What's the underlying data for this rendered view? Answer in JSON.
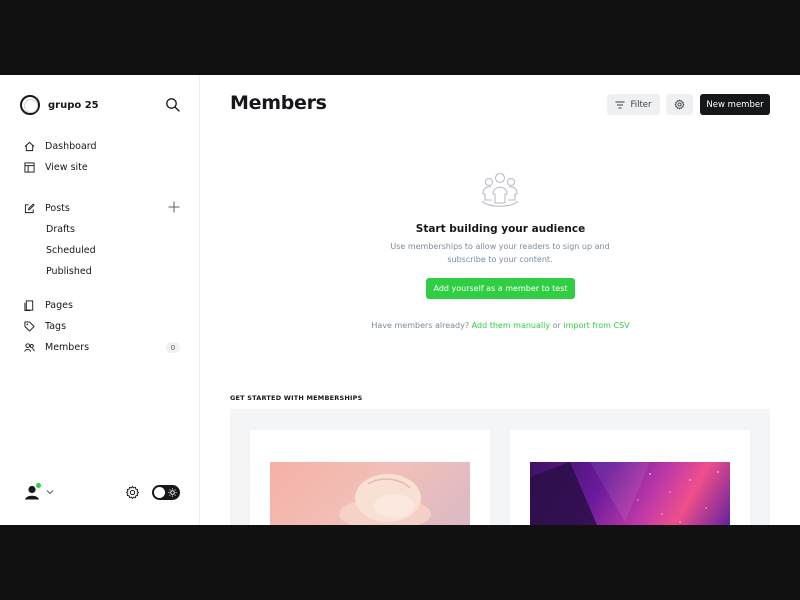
{
  "sidebar": {
    "brand_name": "grupo 25",
    "nav": {
      "dashboard": "Dashboard",
      "view_site": "View site",
      "posts": "Posts",
      "drafts": "Drafts",
      "scheduled": "Scheduled",
      "published": "Published",
      "pages": "Pages",
      "tags": "Tags",
      "members": "Members",
      "members_count": "0"
    }
  },
  "header": {
    "title": "Members",
    "filter_label": "Filter",
    "new_member_label": "New member"
  },
  "empty_state": {
    "title": "Start building your audience",
    "description": "Use memberships to allow your readers to sign up and subscribe to your content.",
    "add_self_label": "Add yourself as a member to test",
    "have_members_prefix": "Have members already?",
    "add_manually_link": "Add them manually",
    "or_text": "or",
    "import_csv_link": "import from CSV"
  },
  "get_started": {
    "label": "GET STARTED WITH MEMBERSHIPS"
  },
  "colors": {
    "accent": "#30cf43",
    "primary_button": "#15171a"
  },
  "icons": {
    "search": "search-icon",
    "dashboard": "home-icon",
    "view_site": "layout-icon",
    "posts": "edit-icon",
    "add": "plus-icon",
    "pages": "pages-icon",
    "tags": "tag-icon",
    "members": "members-icon",
    "filter": "filter-icon",
    "settings": "gear-icon",
    "theme": "sun-icon"
  }
}
